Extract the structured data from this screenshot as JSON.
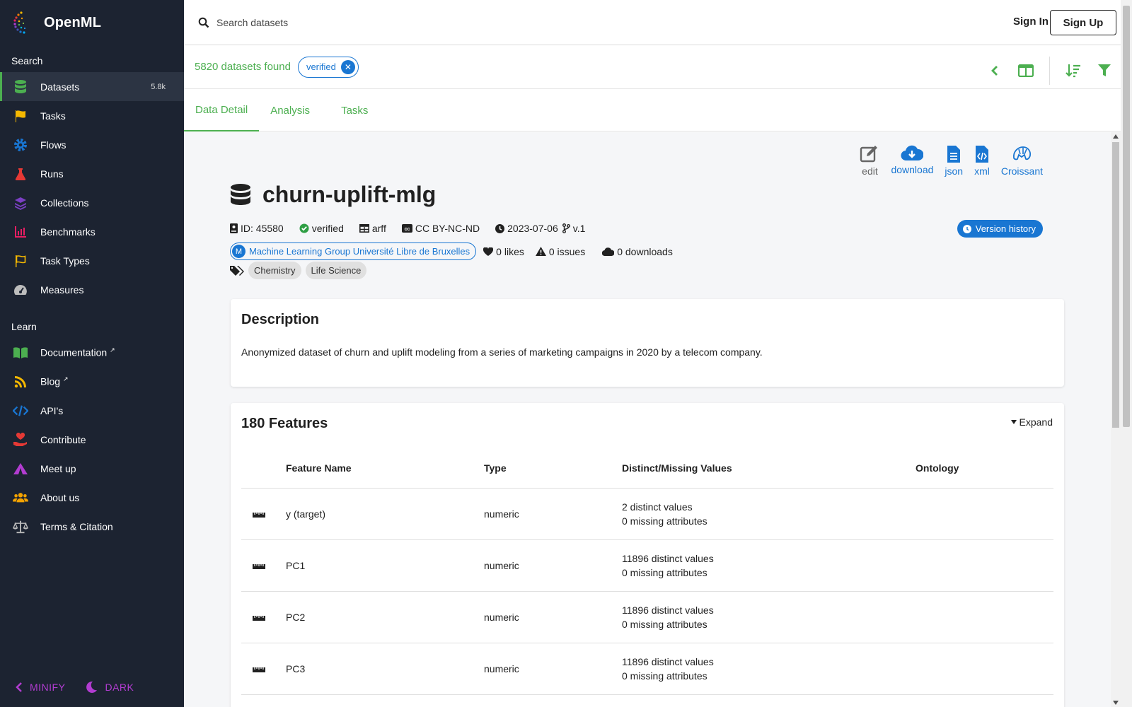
{
  "app": {
    "name": "OpenML"
  },
  "sidebar": {
    "search_title": "Search",
    "learn_title": "Learn",
    "search_items": [
      {
        "label": "Datasets",
        "count": "5.8k",
        "icon": "database-icon",
        "color": "#4caf50"
      },
      {
        "label": "Tasks",
        "icon": "flag-icon",
        "color": "#f5b800"
      },
      {
        "label": "Flows",
        "icon": "cog-icon",
        "color": "#1976d2"
      },
      {
        "label": "Runs",
        "icon": "flask-icon",
        "color": "#e53935"
      },
      {
        "label": "Collections",
        "icon": "layers-icon",
        "color": "#7b3fc4"
      },
      {
        "label": "Benchmarks",
        "icon": "chart-bar-icon",
        "color": "#e91e63"
      },
      {
        "label": "Task Types",
        "icon": "flag-outline-icon",
        "color": "#f5b800"
      },
      {
        "label": "Measures",
        "icon": "gauge-icon",
        "color": "#bdbdbd"
      }
    ],
    "learn_items": [
      {
        "label": "Documentation",
        "icon": "book-icon",
        "color": "#4caf50"
      },
      {
        "label": "Blog",
        "icon": "rss-icon",
        "color": "#f5b800"
      },
      {
        "label": "API's",
        "icon": "code-icon",
        "color": "#1976d2"
      },
      {
        "label": "Contribute",
        "icon": "hand-heart-icon",
        "color": "#e53935"
      },
      {
        "label": "Meet up",
        "icon": "tent-icon",
        "color": "#b23cd1"
      },
      {
        "label": "About us",
        "icon": "users-icon",
        "color": "#f5a300"
      },
      {
        "label": "Terms & Citation",
        "icon": "scale-icon",
        "color": "#bdbdbd"
      }
    ],
    "minify_label": "MINIFY",
    "dark_label": "DARK"
  },
  "topbar": {
    "search_placeholder": "Search datasets",
    "sign_in": "Sign In",
    "sign_up": "Sign Up"
  },
  "results": {
    "found_text": "5820 datasets found",
    "filter_chip": "verified"
  },
  "tabs": [
    "Data Detail",
    "Analysis",
    "Tasks"
  ],
  "actions": [
    {
      "label": "edit",
      "icon": "edit-icon"
    },
    {
      "label": "download",
      "icon": "cloud-download-icon"
    },
    {
      "label": "json",
      "icon": "file-json-icon"
    },
    {
      "label": "xml",
      "icon": "file-code-icon"
    },
    {
      "label": "Croissant",
      "icon": "croissant-icon"
    }
  ],
  "dataset": {
    "title": "churn-uplift-mlg",
    "id_text": "ID: 45580",
    "status": "verified",
    "format": "arff",
    "license": "CC BY-NC-ND",
    "date": "2023-07-06",
    "version": "v.1",
    "creator": "Machine Learning Group Université Libre de Bruxelles",
    "creator_initial": "M",
    "likes": "0 likes",
    "issues": "0 issues",
    "downloads": "0 downloads",
    "tags": [
      "Chemistry",
      "Life Science"
    ],
    "version_history": "Version history"
  },
  "description": {
    "title": "Description",
    "text": "Anonymized dataset of churn and uplift modeling from a series of marketing campaigns in 2020 by a telecom company."
  },
  "features": {
    "title": "180 Features",
    "expand_label": "Expand",
    "columns": [
      "Feature Name",
      "Type",
      "Distinct/Missing Values",
      "Ontology"
    ],
    "rows": [
      {
        "name": "y (target)",
        "type": "numeric",
        "distinct": "2 distinct values",
        "missing": "0 missing attributes"
      },
      {
        "name": "PC1",
        "type": "numeric",
        "distinct": "11896 distinct values",
        "missing": "0 missing attributes"
      },
      {
        "name": "PC2",
        "type": "numeric",
        "distinct": "11896 distinct values",
        "missing": "0 missing attributes"
      },
      {
        "name": "PC3",
        "type": "numeric",
        "distinct": "11896 distinct values",
        "missing": "0 missing attributes"
      }
    ]
  },
  "colors": {
    "sidebar_bg": "#1c2331",
    "accent_green": "#4caf50",
    "link_blue": "#1976d2",
    "foot_purple": "#b23cd1"
  }
}
